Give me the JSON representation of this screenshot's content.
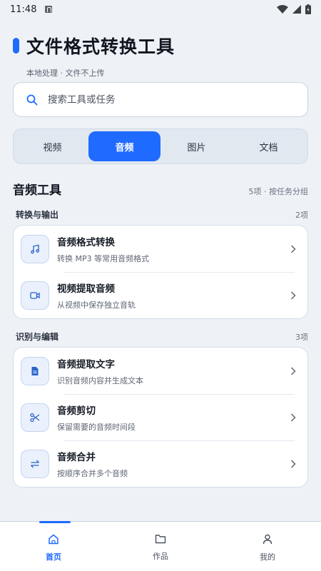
{
  "status": {
    "time": "11:48"
  },
  "header": {
    "title": "文件格式转换工具",
    "subtitle": "本地处理 · 文件不上传"
  },
  "search": {
    "placeholder": "搜索工具或任务"
  },
  "tabs": [
    {
      "label": "视频"
    },
    {
      "label": "音频",
      "active": true
    },
    {
      "label": "图片"
    },
    {
      "label": "文档"
    }
  ],
  "section": {
    "title": "音频工具",
    "meta": "5项 · 按任务分组"
  },
  "groups": [
    {
      "name": "转换与输出",
      "count": "2项",
      "items": [
        {
          "icon": "music-note-icon",
          "title": "音频格式转换",
          "desc": "转换 MP3 等常用音频格式"
        },
        {
          "icon": "video-camera-icon",
          "title": "视频提取音频",
          "desc": "从视频中保存独立音轨"
        }
      ]
    },
    {
      "name": "识别与编辑",
      "count": "3项",
      "items": [
        {
          "icon": "document-icon",
          "title": "音频提取文字",
          "desc": "识别音频内容并生成文本"
        },
        {
          "icon": "scissors-icon",
          "title": "音频剪切",
          "desc": "保留需要的音频时间段"
        },
        {
          "icon": "merge-arrows-icon",
          "title": "音频合并",
          "desc": "按顺序合并多个音频"
        }
      ]
    }
  ],
  "bottom_nav": [
    {
      "label": "首页",
      "icon": "home-icon",
      "active": true
    },
    {
      "label": "作品",
      "icon": "folder-icon"
    },
    {
      "label": "我的",
      "icon": "person-icon"
    }
  ],
  "colors": {
    "accent": "#1f6bff",
    "background": "#eef2f7",
    "icon_bg": "#eaf1fc"
  }
}
